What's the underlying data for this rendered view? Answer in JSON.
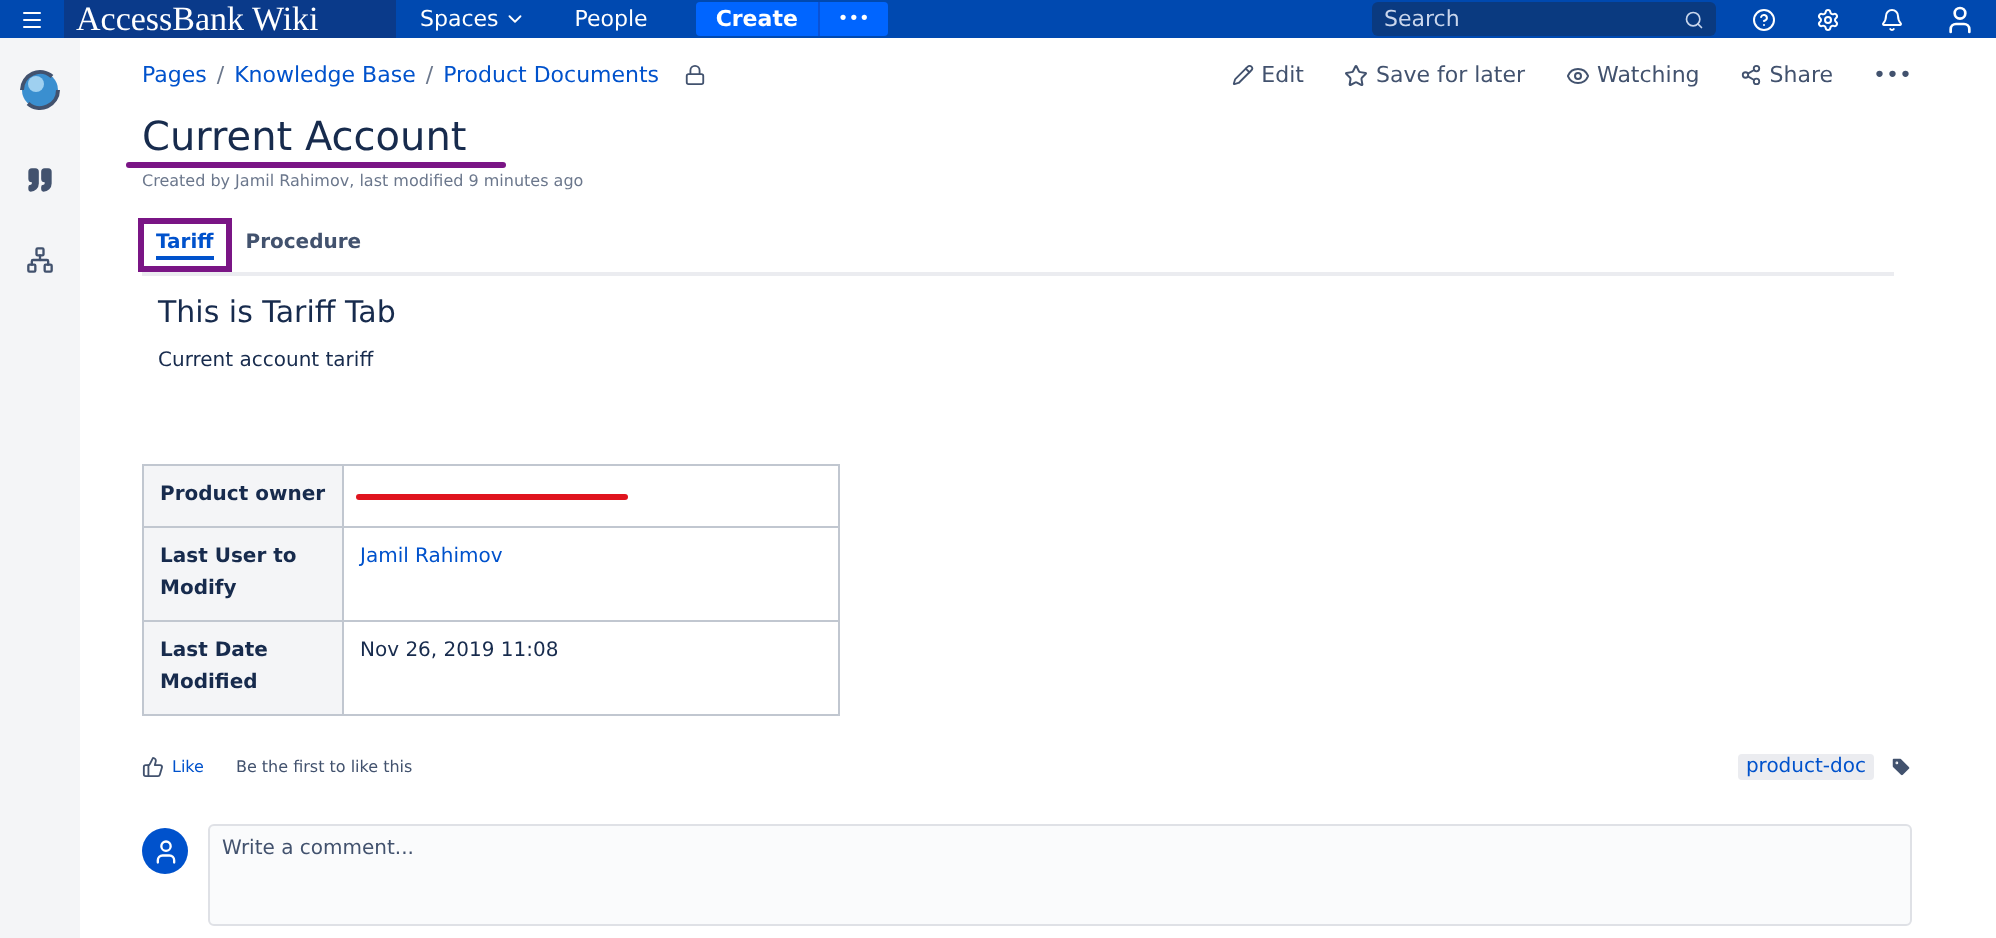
{
  "topbar": {
    "logo": "AccessBank Wiki",
    "nav": [
      {
        "label": "Spaces",
        "dropdown": true
      },
      {
        "label": "People",
        "dropdown": false
      }
    ],
    "create": "Create",
    "more": "•••",
    "search": {
      "placeholder": "Search"
    }
  },
  "breadcrumbs": [
    "Pages",
    "Knowledge Base",
    "Product Documents"
  ],
  "breadcrumb_separator": "/",
  "actions": [
    {
      "kind": "edit",
      "label": "Edit"
    },
    {
      "kind": "star",
      "label": "Save for later"
    },
    {
      "kind": "eye",
      "label": "Watching"
    },
    {
      "kind": "share",
      "label": "Share"
    }
  ],
  "more_actions": "•••",
  "title": "Current Account",
  "title_marked": true,
  "byline": "Created by Jamil Rahimov, last modified 9 minutes ago",
  "tabs": [
    {
      "label": "Tariff",
      "selected": true,
      "marked": true
    },
    {
      "label": "Procedure",
      "selected": false,
      "marked": false
    }
  ],
  "tab_heading": "This is Tariff Tab",
  "tab_text": "Current account tariff",
  "table": {
    "rows": [
      {
        "label": "Product owner",
        "kind": "redacted"
      },
      {
        "label": "Last User to Modify",
        "value": "Jamil Rahimov",
        "kind": "link"
      },
      {
        "label": "Last Date Modified",
        "value": "Nov 26, 2019 11:08",
        "kind": "text"
      }
    ]
  },
  "like": {
    "label": "Like",
    "text": "Be the first to like this"
  },
  "labels": [
    "product-doc"
  ],
  "comment": {
    "placeholder": "Write a comment..."
  }
}
